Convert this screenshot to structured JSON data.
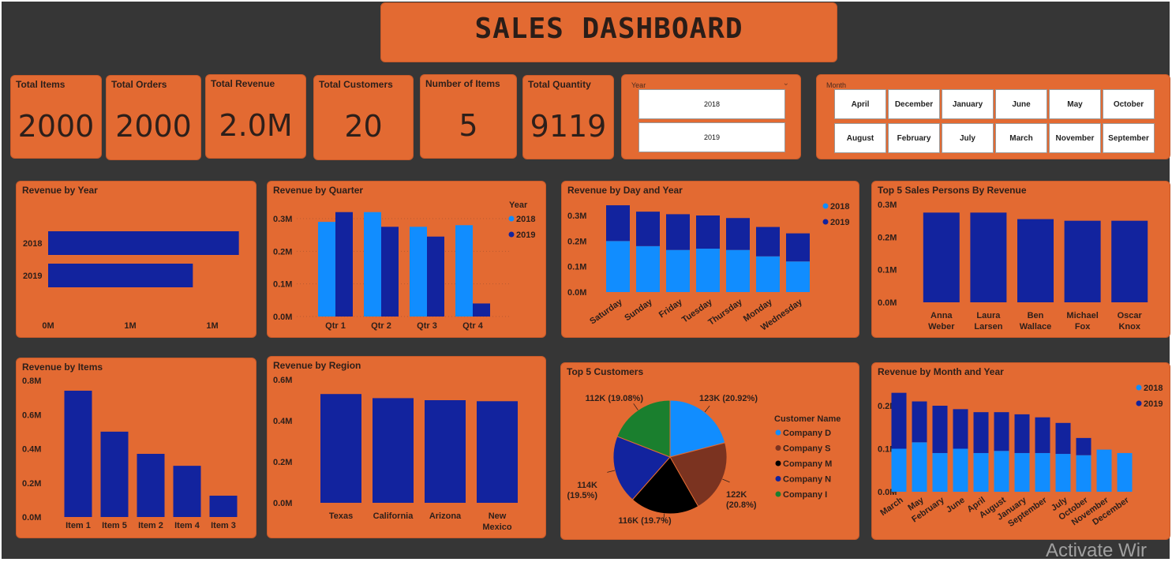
{
  "title": "SALES DASHBOARD",
  "colors": {
    "background": "#363636",
    "panel": "#e36a32",
    "series2018": "#118dff",
    "series2019": "#12239e",
    "green": "#1a7f2e",
    "brown": "#7b3320",
    "black": "#000000"
  },
  "kpis": [
    {
      "label": "Total Items",
      "value": "2000"
    },
    {
      "label": "Total Orders",
      "value": "2000"
    },
    {
      "label": "Total Revenue",
      "value": "2.0M"
    },
    {
      "label": "Total Customers",
      "value": "20"
    },
    {
      "label": "Number of Items",
      "value": "5"
    },
    {
      "label": "Total Quantity",
      "value": "9119"
    }
  ],
  "year_slicer": {
    "label": "Year",
    "icon": "chevron-down-icon",
    "options": [
      "2018",
      "2019"
    ]
  },
  "month_slicer": {
    "label": "Month",
    "options": [
      "April",
      "December",
      "January",
      "June",
      "May",
      "October",
      "August",
      "February",
      "July",
      "March",
      "November",
      "September"
    ]
  },
  "watermark": "Activate Wir",
  "chart_data": [
    {
      "id": "rev_year",
      "type": "bar",
      "orientation": "horizontal",
      "title": "Revenue by Year",
      "categories": [
        "2018",
        "2019"
      ],
      "values": [
        1.16,
        0.88
      ],
      "unit": "M",
      "xlim": [
        0,
        1.2
      ],
      "xticks": [
        "0M",
        "1M",
        "1M"
      ],
      "color": "#12239e"
    },
    {
      "id": "rev_quarter",
      "type": "bar",
      "title": "Revenue by Quarter",
      "categories": [
        "Qtr 1",
        "Qtr 2",
        "Qtr 3",
        "Qtr 4"
      ],
      "legend_title": "Year",
      "series": [
        {
          "name": "2018",
          "values": [
            0.29,
            0.32,
            0.275,
            0.28
          ],
          "color": "#118dff"
        },
        {
          "name": "2019",
          "values": [
            0.32,
            0.275,
            0.245,
            0.04
          ],
          "color": "#12239e"
        }
      ],
      "ylim": [
        0,
        0.3
      ],
      "yticks": [
        "0.0M",
        "0.1M",
        "0.2M",
        "0.3M"
      ]
    },
    {
      "id": "rev_day",
      "type": "bar",
      "stacked": true,
      "title": "Revenue by Day and Year",
      "categories": [
        "Saturday",
        "Sunday",
        "Friday",
        "Tuesday",
        "Thursday",
        "Monday",
        "Wednesday"
      ],
      "series": [
        {
          "name": "2018",
          "values": [
            0.2,
            0.18,
            0.165,
            0.17,
            0.165,
            0.14,
            0.12
          ],
          "color": "#118dff"
        },
        {
          "name": "2019",
          "values": [
            0.14,
            0.135,
            0.14,
            0.13,
            0.125,
            0.115,
            0.11
          ],
          "color": "#12239e"
        }
      ],
      "ylim": [
        0,
        0.3
      ],
      "yticks": [
        "0.0M",
        "0.1M",
        "0.2M",
        "0.3M"
      ]
    },
    {
      "id": "top_sales",
      "type": "bar",
      "title": "Top 5 Sales Persons By Revenue",
      "categories": [
        "Anna\nWeber",
        "Laura\nLarsen",
        "Ben\nWallace",
        "Michael\nFox",
        "Oscar\nKnox"
      ],
      "values": [
        0.275,
        0.275,
        0.255,
        0.25,
        0.25
      ],
      "ylim": [
        0,
        0.3
      ],
      "yticks": [
        "0.0M",
        "0.1M",
        "0.2M",
        "0.3M"
      ],
      "color": "#12239e"
    },
    {
      "id": "rev_items",
      "type": "bar",
      "title": "Revenue by Items",
      "categories": [
        "Item 1",
        "Item 5",
        "Item 2",
        "Item 4",
        "Item 3"
      ],
      "values": [
        0.74,
        0.5,
        0.37,
        0.3,
        0.125
      ],
      "ylim": [
        0,
        0.8
      ],
      "yticks": [
        "0.0M",
        "0.2M",
        "0.4M",
        "0.6M",
        "0.8M"
      ],
      "color": "#12239e"
    },
    {
      "id": "rev_region",
      "type": "bar",
      "title": "Revenue by Region",
      "categories": [
        "Texas",
        "California",
        "Arizona",
        "New\nMexico"
      ],
      "values": [
        0.53,
        0.51,
        0.5,
        0.495
      ],
      "ylim": [
        0,
        0.6
      ],
      "yticks": [
        "0.0M",
        "0.2M",
        "0.4M",
        "0.6M"
      ],
      "color": "#12239e"
    },
    {
      "id": "top_customers",
      "type": "pie",
      "title": "Top 5 Customers",
      "legend_title": "Customer Name",
      "categories": [
        "Company D",
        "Company S",
        "Company M",
        "Company N",
        "Company I"
      ],
      "values": [
        123,
        122,
        116,
        114,
        112
      ],
      "labels": [
        "123K (20.92%)",
        "122K\n(20.8%)",
        "116K (19.7%)",
        "114K\n(19.5%)",
        "112K (19.08%)"
      ],
      "colors": [
        "#118dff",
        "#7b3320",
        "#000000",
        "#12239e",
        "#1a7f2e"
      ]
    },
    {
      "id": "rev_month",
      "type": "bar",
      "stacked": true,
      "title": "Revenue by Month and Year",
      "categories": [
        "March",
        "May",
        "February",
        "June",
        "April",
        "August",
        "January",
        "September",
        "July",
        "October",
        "November",
        "December"
      ],
      "series": [
        {
          "name": "2018",
          "values": [
            0.1,
            0.115,
            0.09,
            0.1,
            0.09,
            0.095,
            0.09,
            0.09,
            0.088,
            0.085,
            0.098,
            0.09
          ],
          "color": "#118dff"
        },
        {
          "name": "2019",
          "values": [
            0.13,
            0.095,
            0.11,
            0.092,
            0.095,
            0.09,
            0.09,
            0.083,
            0.072,
            0.04,
            0,
            0
          ],
          "color": "#12239e"
        }
      ],
      "ylim": [
        0,
        0.2
      ],
      "yticks": [
        "0.0M",
        "0.1M",
        "0.2M"
      ]
    }
  ]
}
